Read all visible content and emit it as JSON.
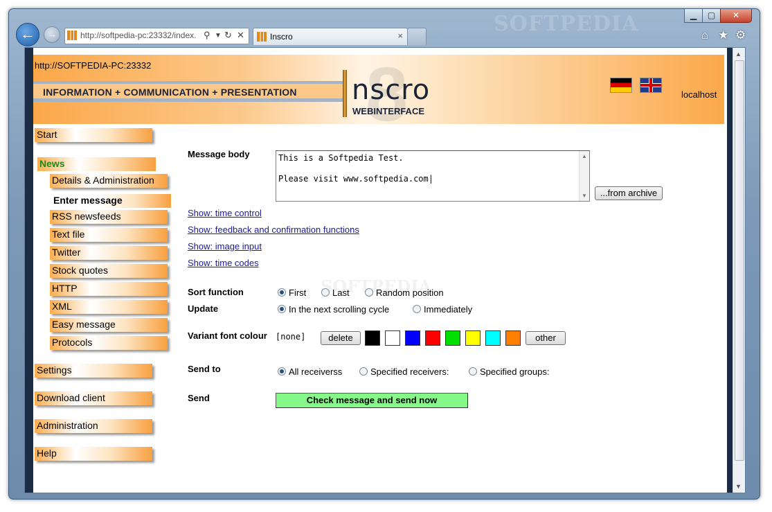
{
  "browser": {
    "address": "http://softpedia-pc:23332/index.",
    "tab_title": "Inscro",
    "watermark": "SOFTPEDIA",
    "window_buttons": {
      "minimize": "▁",
      "maximize": "▢",
      "close": "✕"
    }
  },
  "banner": {
    "url": "http://SOFTPEDIA-PC:23332",
    "tagline": "INFORMATION + COMMUNICATION + PRESENTATION",
    "logo": "nscro",
    "logo_sub": "WEBINTERFACE",
    "logo_digit": "8",
    "host": "localhost"
  },
  "sidebar": {
    "start": "Start",
    "news": "News",
    "news_items": [
      "Details & Administration",
      "Enter message",
      "RSS newsfeeds",
      "Text file",
      "Twitter",
      "Stock quotes",
      "HTTP",
      "XML",
      "Easy message",
      "Protocols"
    ],
    "settings": "Settings",
    "download_client": "Download client",
    "administration": "Administration",
    "help": "Help"
  },
  "form": {
    "message_body_label": "Message body",
    "message_line1": "This is a Softpedia Test.",
    "message_line2": "Please visit www.softpedia.com",
    "from_archive": "...from archive",
    "links": [
      "Show: time control",
      "Show: feedback and confirmation functions",
      "Show: image input",
      "Show: time codes"
    ],
    "sort_label": "Sort function",
    "sort_options": [
      "First",
      "Last",
      "Random position"
    ],
    "sort_selected": "First",
    "update_label": "Update",
    "update_options": [
      "In the next scrolling cycle",
      "Immediately"
    ],
    "update_selected": "In the next scrolling cycle",
    "font_colour_label": "Variant font colour",
    "font_colour_value": "[none]",
    "delete_label": "delete",
    "other_label": "other",
    "colors": [
      "#000000",
      "#ffffff",
      "#0000ff",
      "#ff0000",
      "#00e000",
      "#ffff00",
      "#00ffff",
      "#ff8000"
    ],
    "send_to_label": "Send to",
    "send_to_options": [
      "All receiverss",
      "Specified receivers:",
      "Specified groups:"
    ],
    "send_to_selected": "All receiverss",
    "send_label": "Send",
    "send_button": "Check message and send now"
  }
}
